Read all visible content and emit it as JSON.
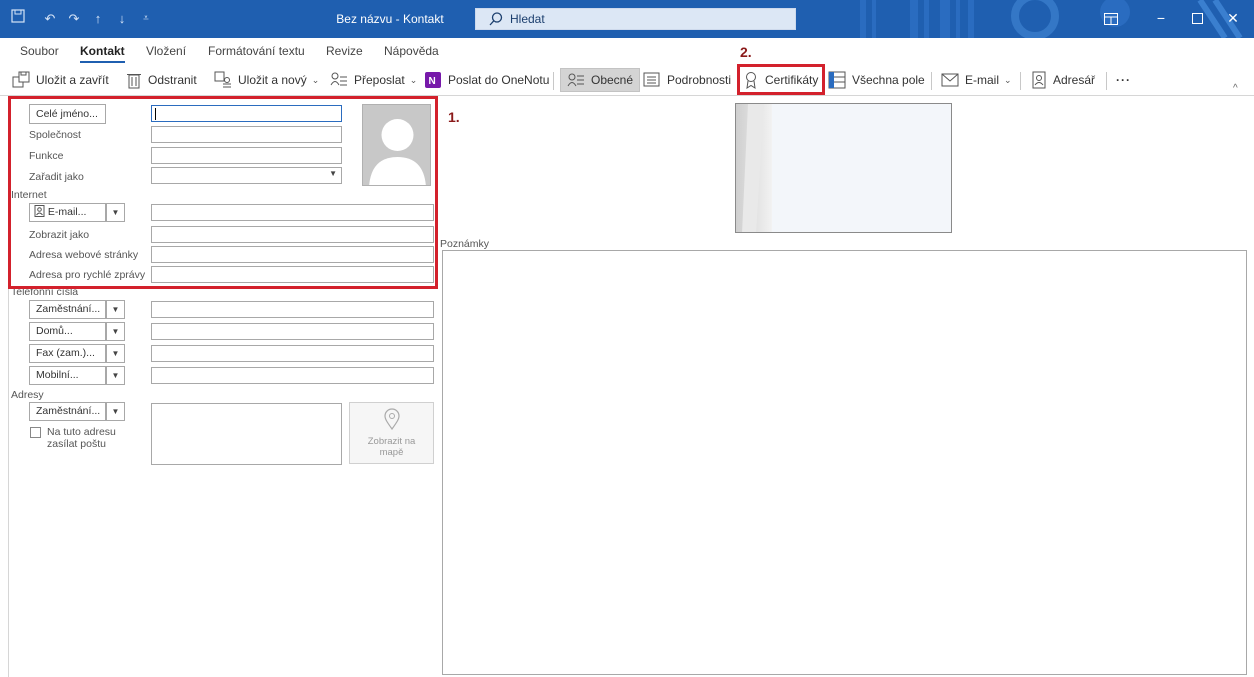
{
  "titlebar": {
    "title": "Bez názvu  -  Kontakt",
    "search_label": "Hledat",
    "icons": [
      "save-icon",
      "undo-icon",
      "redo-icon",
      "up-icon",
      "down-icon",
      "customize-icon"
    ],
    "colors": {
      "titlebar": "#1f5fb0"
    }
  },
  "ribbon_tabs": [
    "Soubor",
    "Kontakt",
    "Vložení",
    "Formátování textu",
    "Revize",
    "Nápověda"
  ],
  "ribbon": {
    "save_close": "Uložit a zavřít",
    "delete": "Odstranit",
    "save_new": "Uložit a nový",
    "forward": "Přeposlat",
    "onenote": "Poslat do OneNotu",
    "general": "Obecné",
    "details": "Podrobnosti",
    "certificates": "Certifikáty",
    "all_fields": "Všechna pole",
    "email": "E-mail",
    "address_book": "Adresář",
    "more": "···"
  },
  "form": {
    "full_name_button": "Celé jméno...",
    "company": "Společnost",
    "job_title": "Funkce",
    "file_as": "Zařadit jako",
    "internet_section": "Internet",
    "email_button": "E-mail...",
    "display_as": "Zobrazit jako",
    "web_page": "Adresa webové stránky",
    "im_address": "Adresa pro rychlé zprávy",
    "phones_section": "Telefonní čísla",
    "phone_business": "Zaměstnání...",
    "phone_home": "Domů...",
    "phone_fax": "Fax (zam.)...",
    "phone_mobile": "Mobilní...",
    "addresses_section": "Adresy",
    "address_business": "Zaměstnání...",
    "mailing_address_checkbox": "Na tuto adresu zasílat poštu",
    "map_button_line1": "Zobrazit na",
    "map_button_line2": "mapě",
    "notes_label": "Poznámky"
  },
  "annotations": {
    "marker_1": "1.",
    "marker_2": "2.",
    "color": "#d3212c"
  }
}
